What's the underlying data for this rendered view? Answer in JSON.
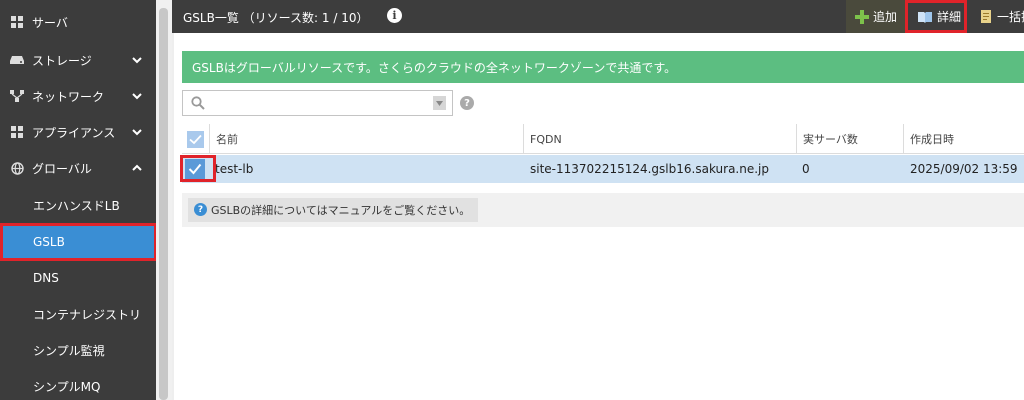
{
  "sidebar": {
    "items": [
      {
        "label": "サーバ",
        "icon": "server-icon",
        "has_chevron": false
      },
      {
        "label": "ストレージ",
        "icon": "storage-icon",
        "has_chevron": true
      },
      {
        "label": "ネットワーク",
        "icon": "network-icon",
        "has_chevron": true
      },
      {
        "label": "アプライアンス",
        "icon": "appliance-icon",
        "has_chevron": true
      },
      {
        "label": "グローバル",
        "icon": "globe-icon",
        "has_chevron": true,
        "expanded": true
      }
    ],
    "sub_items": [
      {
        "label": "エンハンスドLB",
        "active": false
      },
      {
        "label": "GSLB",
        "active": true
      },
      {
        "label": "DNS",
        "active": false
      },
      {
        "label": "コンテナレジストリ",
        "active": false
      },
      {
        "label": "シンプル監視",
        "active": false
      },
      {
        "label": "シンプルMQ",
        "active": false
      }
    ]
  },
  "header": {
    "title": "GSLB一覧 （リソース数: 1 / 10）",
    "buttons": {
      "add_label": "追加",
      "detail_label": "詳細",
      "bulk_label": "一括操作"
    }
  },
  "notice": {
    "text": "GSLBはグローバルリソースです。さくらのクラウドの全ネットワークゾーンで共通です。"
  },
  "search": {
    "placeholder": ""
  },
  "table": {
    "columns": [
      "名前",
      "FQDN",
      "実サーバ数",
      "作成日時"
    ],
    "rows": [
      {
        "selected": true,
        "name": "test-lb",
        "fqdn": "site-113702215124.gslb16.sakura.ne.jp",
        "servers": "0",
        "created": "2025/09/02 13:59"
      }
    ]
  },
  "footer": {
    "help_text": "GSLBの詳細についてはマニュアルをご覧ください。"
  },
  "colors": {
    "active_blue": "#3a8ed4",
    "notice_green": "#5cbe81",
    "highlight_red": "#e0232a",
    "add_green": "#7dc24b"
  }
}
